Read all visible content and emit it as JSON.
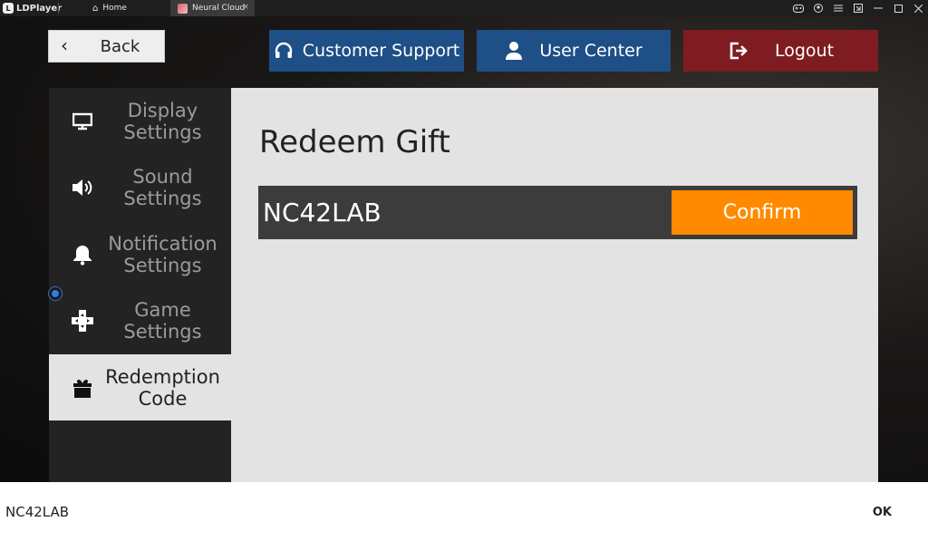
{
  "titlebar": {
    "app_name": "LDPlayer",
    "logo_letter": "L",
    "tabs": [
      {
        "label": "Home"
      },
      {
        "label": "Neural Cloud"
      }
    ],
    "tab_close": "×"
  },
  "topbar": {
    "back_label": "Back",
    "customer_support_label": "Customer Support",
    "user_center_label": "User Center",
    "logout_label": "Logout"
  },
  "sidebar": {
    "items": [
      {
        "line1": "Display",
        "line2": "Settings"
      },
      {
        "line1": "Sound",
        "line2": "Settings"
      },
      {
        "line1": "Notification",
        "line2": "Settings"
      },
      {
        "line1": "Game",
        "line2": "Settings"
      },
      {
        "line1": "Redemption",
        "line2": "Code"
      }
    ]
  },
  "panel": {
    "title": "Redeem Gift",
    "code_value": "NC42LAB",
    "confirm_label": "Confirm"
  },
  "ime": {
    "text": "NC42LAB",
    "ok_label": "OK"
  },
  "colors": {
    "primary_blue": "#1e4f86",
    "logout_red": "#7f1c21",
    "confirm_orange": "#ff8a00",
    "active_item": "#e3e3e3",
    "sidebar_bg": "#232323"
  }
}
